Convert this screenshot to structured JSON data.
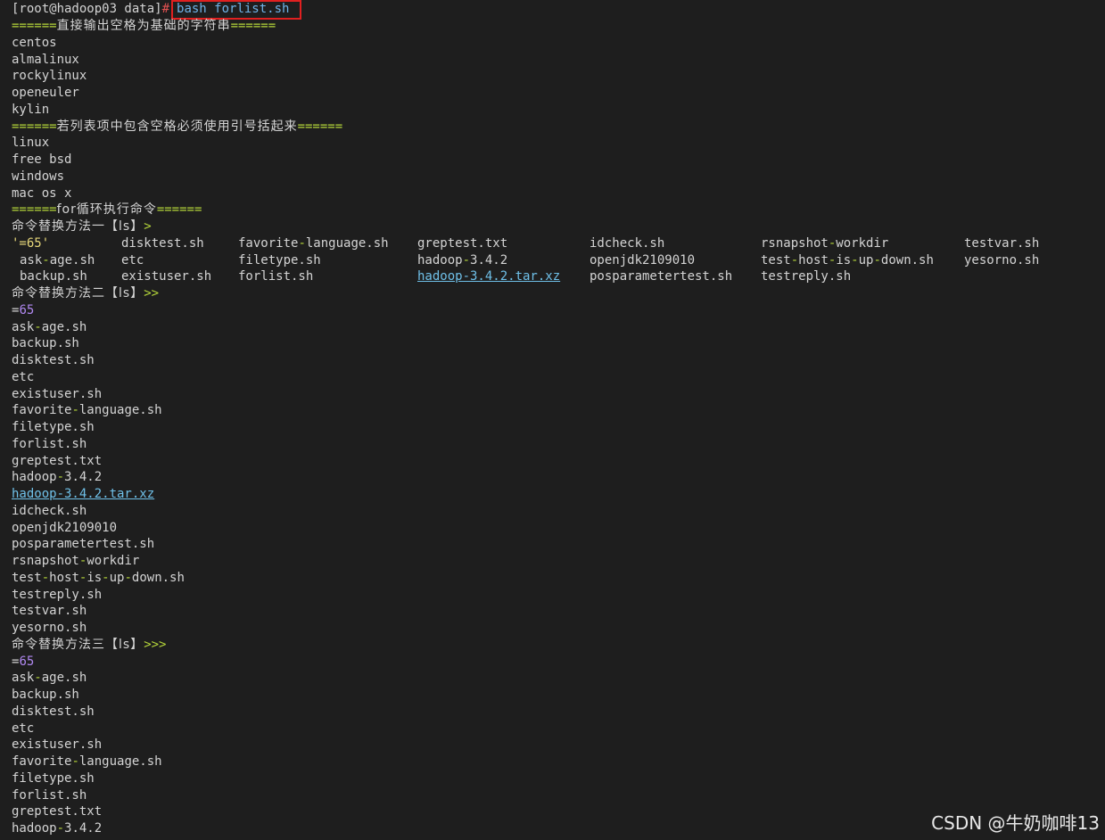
{
  "prompt": {
    "user_host": "[root@hadoop03 data]",
    "hash": "#",
    "command": "bash forlist.sh"
  },
  "section1": {
    "sep": "======",
    "title": "直接输出空格为基础的字符串",
    "items": [
      "centos",
      "almalinux",
      "rockylinux",
      "openeuler",
      "kylin"
    ]
  },
  "section2": {
    "sep": "======",
    "title": "若列表项中包含空格必须使用引号括起来",
    "items": [
      "linux",
      "free bsd",
      "windows",
      "mac os x"
    ]
  },
  "section3": {
    "sep": "======",
    "title": "for循环执行命令"
  },
  "method1": {
    "title": "命令替换方法一【ls】",
    "suffix": ">",
    "grid": [
      [
        "'=65'",
        "disktest.sh",
        "favorite-language.sh",
        "greptest.txt",
        "idcheck.sh",
        "rsnapshot-workdir",
        "testvar.sh"
      ],
      [
        "ask-age.sh",
        "etc",
        "filetype.sh",
        "hadoop-3.4.2",
        "openjdk2109010",
        "test-host-is-up-down.sh",
        "yesorno.sh"
      ],
      [
        "backup.sh",
        "existuser.sh",
        "forlist.sh",
        "hadoop-3.4.2.tar.xz",
        "posparametertest.sh",
        "testreply.sh",
        ""
      ]
    ]
  },
  "method2": {
    "title": "命令替换方法二【ls】",
    "suffix": ">>",
    "first": "=65",
    "items": [
      "ask-age.sh",
      "backup.sh",
      "disktest.sh",
      "etc",
      "existuser.sh",
      "favorite-language.sh",
      "filetype.sh",
      "forlist.sh",
      "greptest.txt",
      "hadoop-3.4.2",
      "hadoop-3.4.2.tar.xz",
      "idcheck.sh",
      "openjdk2109010",
      "posparametertest.sh",
      "rsnapshot-workdir",
      "test-host-is-up-down.sh",
      "testreply.sh",
      "testvar.sh",
      "yesorno.sh"
    ]
  },
  "method3": {
    "title": "命令替换方法三【ls】",
    "suffix": ">>>",
    "first": "=65",
    "items": [
      "ask-age.sh",
      "backup.sh",
      "disktest.sh",
      "etc",
      "existuser.sh",
      "favorite-language.sh",
      "filetype.sh",
      "forlist.sh",
      "greptest.txt",
      "hadoop-3.4.2"
    ]
  },
  "link_items": [
    "hadoop-3.4.2.tar.xz"
  ],
  "watermark": "CSDN @牛奶咖啡13",
  "colors": {
    "background": "#1e1e1e",
    "text": "#d4d4d4",
    "separator": "#b5d63a",
    "number": "#b088f0",
    "quoted": "#e7d77a",
    "link": "#6fc0e8",
    "highlight_box": "#e02020"
  }
}
